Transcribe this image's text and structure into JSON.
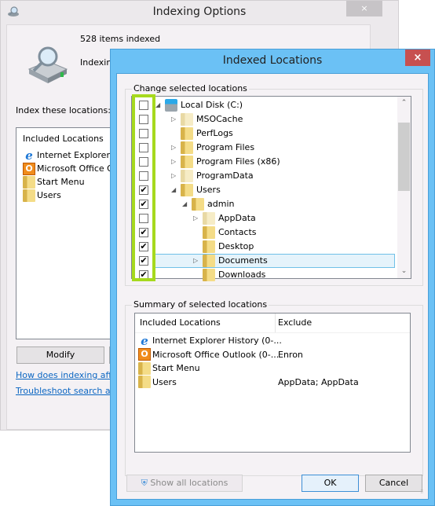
{
  "back_window": {
    "title": "Indexing Options",
    "close_glyph": "×",
    "items_indexed": "528 items indexed",
    "indexing_status": "Indexing",
    "index_label": "Index these locations:",
    "list_header": "Included Locations",
    "locations": [
      {
        "icon": "ie-icon",
        "label": "Internet Explorer Histo"
      },
      {
        "icon": "outlook-icon",
        "label": "Microsoft Office Outl"
      },
      {
        "icon": "folder-icon",
        "label": "Start Menu"
      },
      {
        "icon": "folder-icon",
        "label": "Users"
      }
    ],
    "modify_button": "Modify",
    "link_how": "How does indexing affect",
    "link_troubleshoot": "Troubleshoot search and"
  },
  "front_window": {
    "title": "Indexed Locations",
    "close_glyph": "×",
    "change_group_label": "Change selected locations",
    "tree": [
      {
        "label": "Local Disk (C:)",
        "checked": false,
        "level": 0,
        "expander": "expanded",
        "icon": "disk-icon"
      },
      {
        "label": "MSOCache",
        "checked": false,
        "level": 1,
        "expander": "collapsed",
        "icon": "folder-pale-icon"
      },
      {
        "label": "PerfLogs",
        "checked": false,
        "level": 1,
        "expander": "none",
        "icon": "folder-icon"
      },
      {
        "label": "Program Files",
        "checked": false,
        "level": 1,
        "expander": "collapsed",
        "icon": "folder-icon"
      },
      {
        "label": "Program Files (x86)",
        "checked": false,
        "level": 1,
        "expander": "collapsed",
        "icon": "folder-icon"
      },
      {
        "label": "ProgramData",
        "checked": false,
        "level": 1,
        "expander": "collapsed",
        "icon": "folder-pale-icon"
      },
      {
        "label": "Users",
        "checked": true,
        "level": 1,
        "expander": "expanded",
        "icon": "folder-icon"
      },
      {
        "label": "admin",
        "checked": true,
        "level": 2,
        "expander": "expanded",
        "icon": "folder-icon"
      },
      {
        "label": "AppData",
        "checked": false,
        "level": 3,
        "expander": "collapsed",
        "icon": "folder-pale-icon"
      },
      {
        "label": "Contacts",
        "checked": true,
        "level": 3,
        "expander": "none",
        "icon": "contacts-folder-icon"
      },
      {
        "label": "Desktop",
        "checked": true,
        "level": 3,
        "expander": "none",
        "icon": "desktop-folder-icon"
      },
      {
        "label": "Documents",
        "checked": true,
        "level": 3,
        "expander": "collapsed",
        "icon": "documents-folder-icon",
        "selected": true
      },
      {
        "label": "Downloads",
        "checked": true,
        "level": 3,
        "expander": "none",
        "icon": "downloads-folder-icon"
      }
    ],
    "summary_group_label": "Summary of selected locations",
    "summary_headers": {
      "included": "Included Locations",
      "exclude": "Exclude"
    },
    "summary_rows": [
      {
        "icon": "ie-icon",
        "included": "Internet Explorer History (0-...",
        "exclude": ""
      },
      {
        "icon": "outlook-icon",
        "included": "Microsoft Office Outlook (0-...",
        "exclude": "Enron"
      },
      {
        "icon": "folder-icon",
        "included": "Start Menu",
        "exclude": ""
      },
      {
        "icon": "folder-icon",
        "included": "Users",
        "exclude": "AppData; AppData"
      }
    ],
    "show_all_button": "Show all locations",
    "ok_button": "OK",
    "cancel_button": "Cancel",
    "check_glyph": "✔",
    "expanded_glyph": "◢",
    "collapsed_glyph": "▷",
    "scroll_up_glyph": "⌃",
    "scroll_down_glyph": "⌄"
  },
  "colors": {
    "front_frame": "#6bc1f5",
    "close_red": "#c75050",
    "highlight_green": "#a6d91e",
    "link_blue": "#0b66c2",
    "selection_bg": "#e5f3fb",
    "selection_border": "#70c0e7"
  }
}
